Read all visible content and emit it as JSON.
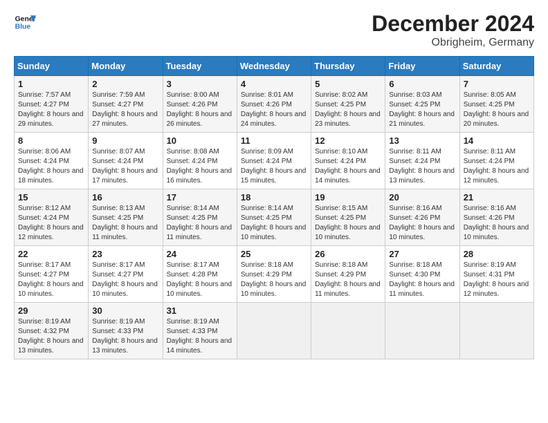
{
  "header": {
    "logo_line1": "General",
    "logo_line2": "Blue",
    "month": "December 2024",
    "location": "Obrigheim, Germany"
  },
  "days_of_week": [
    "Sunday",
    "Monday",
    "Tuesday",
    "Wednesday",
    "Thursday",
    "Friday",
    "Saturday"
  ],
  "weeks": [
    [
      {
        "day": 1,
        "sunrise": "7:57 AM",
        "sunset": "4:27 PM",
        "daylight": "8 hours and 29 minutes."
      },
      {
        "day": 2,
        "sunrise": "7:59 AM",
        "sunset": "4:27 PM",
        "daylight": "8 hours and 27 minutes."
      },
      {
        "day": 3,
        "sunrise": "8:00 AM",
        "sunset": "4:26 PM",
        "daylight": "8 hours and 26 minutes."
      },
      {
        "day": 4,
        "sunrise": "8:01 AM",
        "sunset": "4:26 PM",
        "daylight": "8 hours and 24 minutes."
      },
      {
        "day": 5,
        "sunrise": "8:02 AM",
        "sunset": "4:25 PM",
        "daylight": "8 hours and 23 minutes."
      },
      {
        "day": 6,
        "sunrise": "8:03 AM",
        "sunset": "4:25 PM",
        "daylight": "8 hours and 21 minutes."
      },
      {
        "day": 7,
        "sunrise": "8:05 AM",
        "sunset": "4:25 PM",
        "daylight": "8 hours and 20 minutes."
      }
    ],
    [
      {
        "day": 8,
        "sunrise": "8:06 AM",
        "sunset": "4:24 PM",
        "daylight": "8 hours and 18 minutes."
      },
      {
        "day": 9,
        "sunrise": "8:07 AM",
        "sunset": "4:24 PM",
        "daylight": "8 hours and 17 minutes."
      },
      {
        "day": 10,
        "sunrise": "8:08 AM",
        "sunset": "4:24 PM",
        "daylight": "8 hours and 16 minutes."
      },
      {
        "day": 11,
        "sunrise": "8:09 AM",
        "sunset": "4:24 PM",
        "daylight": "8 hours and 15 minutes."
      },
      {
        "day": 12,
        "sunrise": "8:10 AM",
        "sunset": "4:24 PM",
        "daylight": "8 hours and 14 minutes."
      },
      {
        "day": 13,
        "sunrise": "8:11 AM",
        "sunset": "4:24 PM",
        "daylight": "8 hours and 13 minutes."
      },
      {
        "day": 14,
        "sunrise": "8:11 AM",
        "sunset": "4:24 PM",
        "daylight": "8 hours and 12 minutes."
      }
    ],
    [
      {
        "day": 15,
        "sunrise": "8:12 AM",
        "sunset": "4:24 PM",
        "daylight": "8 hours and 12 minutes."
      },
      {
        "day": 16,
        "sunrise": "8:13 AM",
        "sunset": "4:25 PM",
        "daylight": "8 hours and 11 minutes."
      },
      {
        "day": 17,
        "sunrise": "8:14 AM",
        "sunset": "4:25 PM",
        "daylight": "8 hours and 11 minutes."
      },
      {
        "day": 18,
        "sunrise": "8:14 AM",
        "sunset": "4:25 PM",
        "daylight": "8 hours and 10 minutes."
      },
      {
        "day": 19,
        "sunrise": "8:15 AM",
        "sunset": "4:25 PM",
        "daylight": "8 hours and 10 minutes."
      },
      {
        "day": 20,
        "sunrise": "8:16 AM",
        "sunset": "4:26 PM",
        "daylight": "8 hours and 10 minutes."
      },
      {
        "day": 21,
        "sunrise": "8:16 AM",
        "sunset": "4:26 PM",
        "daylight": "8 hours and 10 minutes."
      }
    ],
    [
      {
        "day": 22,
        "sunrise": "8:17 AM",
        "sunset": "4:27 PM",
        "daylight": "8 hours and 10 minutes."
      },
      {
        "day": 23,
        "sunrise": "8:17 AM",
        "sunset": "4:27 PM",
        "daylight": "8 hours and 10 minutes."
      },
      {
        "day": 24,
        "sunrise": "8:17 AM",
        "sunset": "4:28 PM",
        "daylight": "8 hours and 10 minutes."
      },
      {
        "day": 25,
        "sunrise": "8:18 AM",
        "sunset": "4:29 PM",
        "daylight": "8 hours and 10 minutes."
      },
      {
        "day": 26,
        "sunrise": "8:18 AM",
        "sunset": "4:29 PM",
        "daylight": "8 hours and 11 minutes."
      },
      {
        "day": 27,
        "sunrise": "8:18 AM",
        "sunset": "4:30 PM",
        "daylight": "8 hours and 11 minutes."
      },
      {
        "day": 28,
        "sunrise": "8:19 AM",
        "sunset": "4:31 PM",
        "daylight": "8 hours and 12 minutes."
      }
    ],
    [
      {
        "day": 29,
        "sunrise": "8:19 AM",
        "sunset": "4:32 PM",
        "daylight": "8 hours and 13 minutes."
      },
      {
        "day": 30,
        "sunrise": "8:19 AM",
        "sunset": "4:33 PM",
        "daylight": "8 hours and 13 minutes."
      },
      {
        "day": 31,
        "sunrise": "8:19 AM",
        "sunset": "4:33 PM",
        "daylight": "8 hours and 14 minutes."
      },
      null,
      null,
      null,
      null
    ]
  ],
  "labels": {
    "sunrise": "Sunrise:",
    "sunset": "Sunset:",
    "daylight": "Daylight:"
  }
}
